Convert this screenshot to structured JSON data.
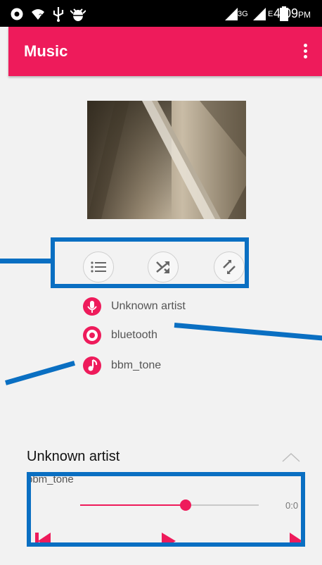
{
  "status_bar": {
    "icons": [
      "record-icon",
      "wifi-icon",
      "usb-icon",
      "android-debug-icon",
      "signal-3g-icon",
      "signal-e-icon",
      "battery-icon"
    ],
    "network_3g": "3G",
    "network_e": "E",
    "time": "4:09",
    "ampm": "PM"
  },
  "app_bar": {
    "title": "Music",
    "menu_icon": "more-vert-icon"
  },
  "colors": {
    "accent": "#ee1b5b",
    "annotation": "#0a6fc2",
    "background": "#f2f2f2"
  },
  "controls": [
    {
      "name": "playlist-icon"
    },
    {
      "name": "shuffle-icon"
    },
    {
      "name": "repeat-icon"
    }
  ],
  "track_info": {
    "artist": "Unknown artist",
    "album": "bluetooth",
    "title": "bbm_tone"
  },
  "now_playing": {
    "artist": "Unknown artist",
    "title": "bbm_tone",
    "progress": 0.59,
    "duration": "0:0"
  }
}
